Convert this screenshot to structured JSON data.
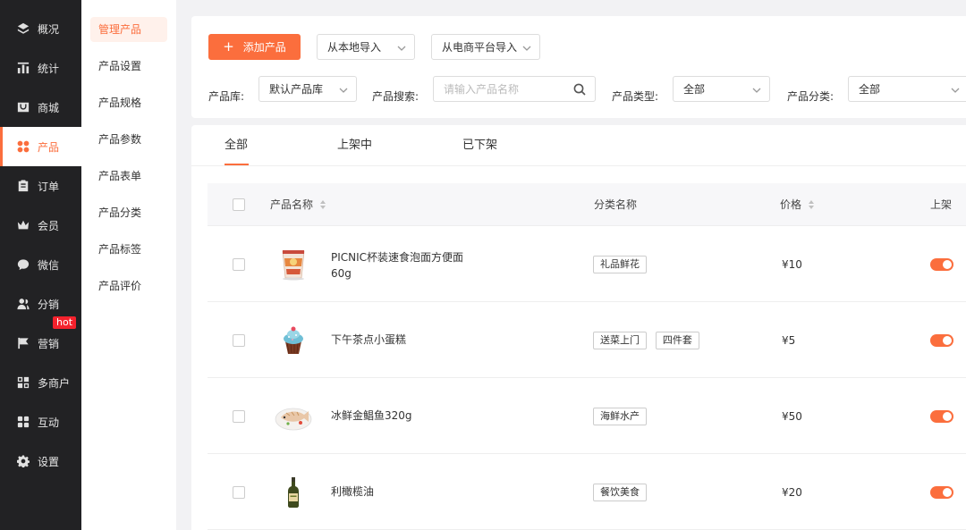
{
  "nav": {
    "items": [
      {
        "label": "概况",
        "icon": "layers-icon"
      },
      {
        "label": "统计",
        "icon": "bar-chart-icon"
      },
      {
        "label": "商城",
        "icon": "shop-icon"
      },
      {
        "label": "产品",
        "icon": "grid-icon",
        "active": true
      },
      {
        "label": "订单",
        "icon": "clipboard-icon"
      },
      {
        "label": "会员",
        "icon": "crown-icon"
      },
      {
        "label": "微信",
        "icon": "wechat-icon"
      },
      {
        "label": "分销",
        "icon": "users-icon"
      },
      {
        "label": "营销",
        "icon": "flag-icon",
        "badge": "hot"
      },
      {
        "label": "多商户",
        "icon": "store-icon"
      },
      {
        "label": "互动",
        "icon": "interact-icon"
      },
      {
        "label": "设置",
        "icon": "gear-icon"
      }
    ]
  },
  "subnav": {
    "items": [
      "管理产品",
      "产品设置",
      "产品规格",
      "产品参数",
      "产品表单",
      "产品分类",
      "产品标签",
      "产品评价"
    ],
    "active_index": 0
  },
  "toolbar": {
    "add_label": "添加产品",
    "import_local_label": "从本地导入",
    "import_platform_label": "从电商平台导入"
  },
  "filters": {
    "library_label": "产品库:",
    "library_value": "默认产品库",
    "search_label": "产品搜索:",
    "search_placeholder": "请输入产品名称",
    "type_label": "产品类型:",
    "type_value": "全部",
    "category_label": "产品分类:",
    "category_value": "全部"
  },
  "tabs": [
    "全部",
    "上架中",
    "已下架"
  ],
  "table": {
    "headers": {
      "name": "产品名称",
      "category": "分类名称",
      "price": "价格",
      "status": "上架"
    },
    "rows": [
      {
        "name": "PICNIC杯装速食泡面方便面60g",
        "tags": [
          "礼品鲜花"
        ],
        "price": "¥10",
        "on_shelf": true,
        "thumb": "noodle-cup-image"
      },
      {
        "name": "下午茶点小蛋糕",
        "tags": [
          "送菜上门",
          "四件套"
        ],
        "price": "¥5",
        "on_shelf": true,
        "thumb": "cupcake-image"
      },
      {
        "name": "冰鲜金鲳鱼320g",
        "tags": [
          "海鲜水产"
        ],
        "price": "¥50",
        "on_shelf": true,
        "thumb": "fish-plate-image"
      },
      {
        "name": "利橄榄油",
        "tags": [
          "餐饮美食"
        ],
        "price": "¥20",
        "on_shelf": true,
        "thumb": "olive-oil-image"
      }
    ]
  },
  "colors": {
    "accent": "#fb6e3d",
    "sidebar": "#222224",
    "badge": "#f5222d"
  }
}
